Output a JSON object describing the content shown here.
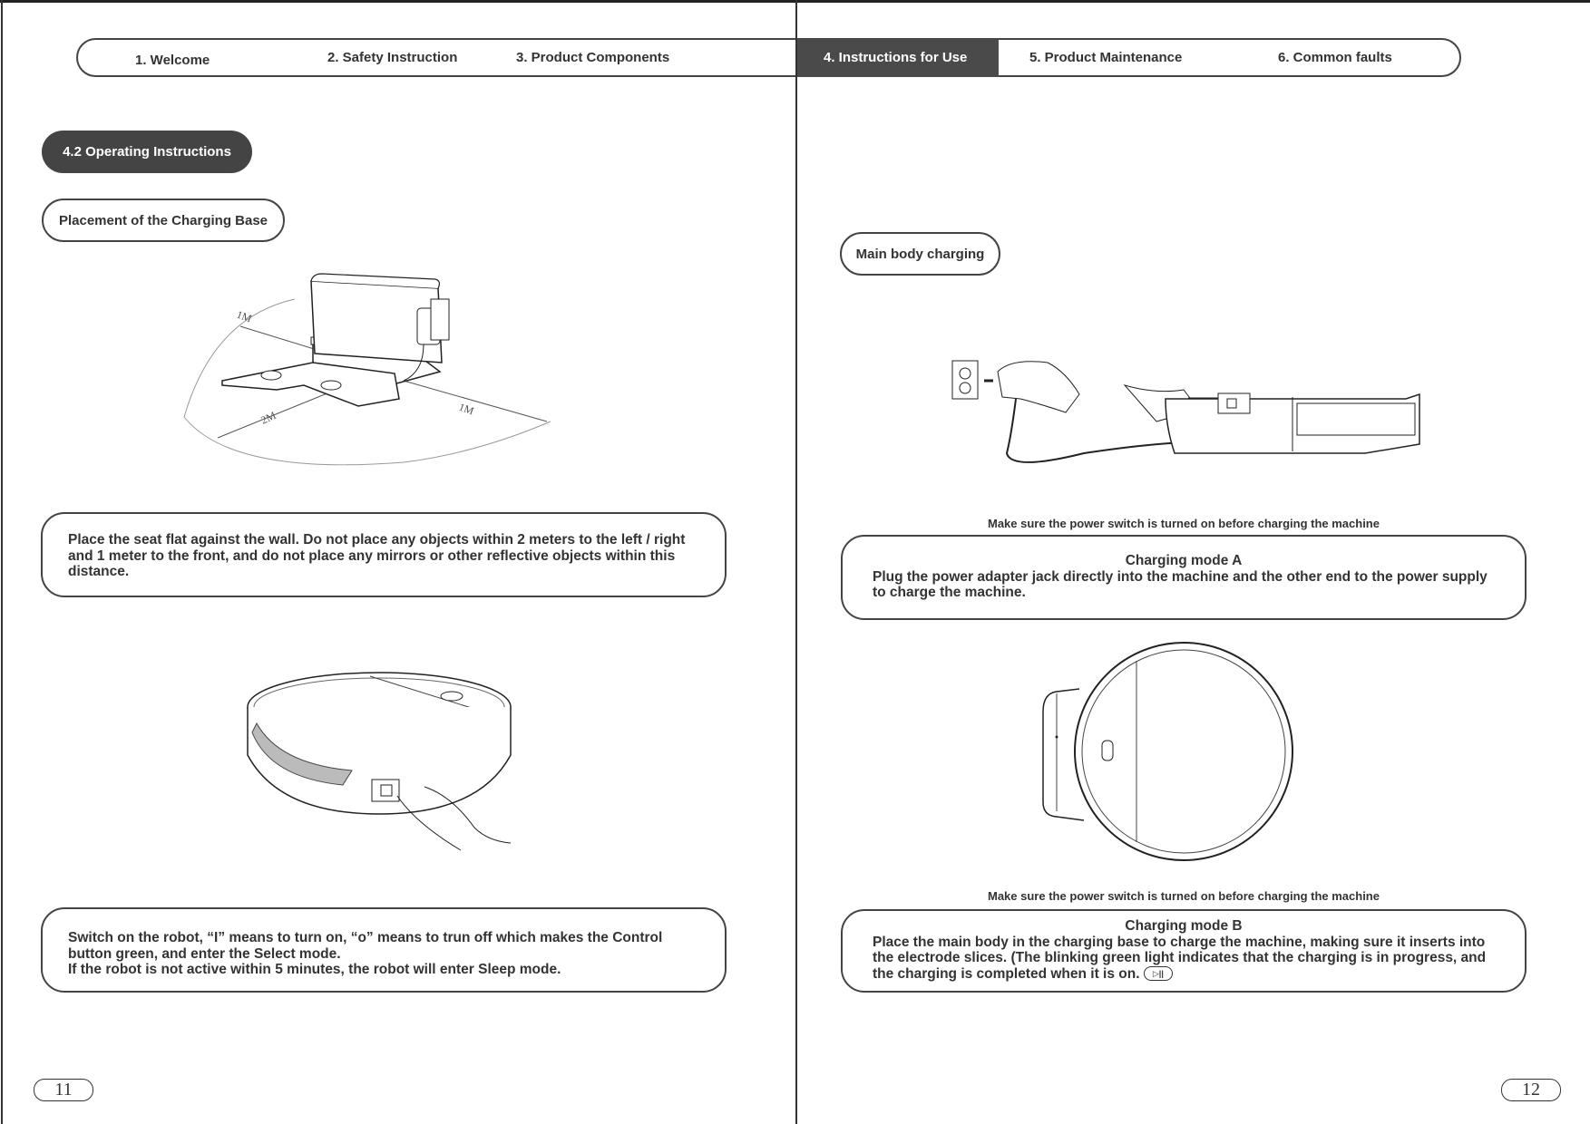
{
  "nav": {
    "tabs": [
      {
        "label": "1. Welcome",
        "active": false
      },
      {
        "label": "2. Safety Instruction",
        "active": false
      },
      {
        "label": "3. Product Components",
        "active": false
      },
      {
        "label": "4. Instructions for Use",
        "active": true
      },
      {
        "label": "5. Product Maintenance",
        "active": false
      },
      {
        "label": "6. Common faults",
        "active": false
      }
    ],
    "active_color": "#4a4a4a"
  },
  "left_page": {
    "section_title": "4.2 Operating Instructions",
    "subsection_title": "Placement of the Charging Base",
    "diagram_labels": {
      "left": "1M",
      "right": "1M",
      "front": "2M"
    },
    "placement_text": "Place the seat flat against the wall. Do not place any objects within 2 meters to the left / right and 1 meter to the front, and do not place any mirrors or other reflective objects within this distance.",
    "switch_text_1": "Switch on the robot, “I” means to turn on, “o” means to trun off which makes the Control button green, and enter the Select mode.",
    "switch_text_2": "If the robot is not active within 5 minutes, the robot will enter Sleep mode.",
    "page_number": "11"
  },
  "right_page": {
    "subsection_title": "Main body charging",
    "caption_a": "Make sure the power switch is turned on before charging the machine",
    "mode_a_title": "Charging mode A",
    "mode_a_text": "Plug the power adapter jack directly into the machine and the other end to the power supply to charge the machine.",
    "caption_b": "Make sure the power switch is turned on before charging the machine",
    "mode_b_title": "Charging mode B",
    "mode_b_text": "Place the main body in the charging base to charge the machine, making sure it inserts into the electrode slices. (The blinking green light indicates that the charging is in progress, and the charging is completed when it is on.",
    "mode_b_icon": "play-pause-button-icon",
    "page_number": "12"
  }
}
